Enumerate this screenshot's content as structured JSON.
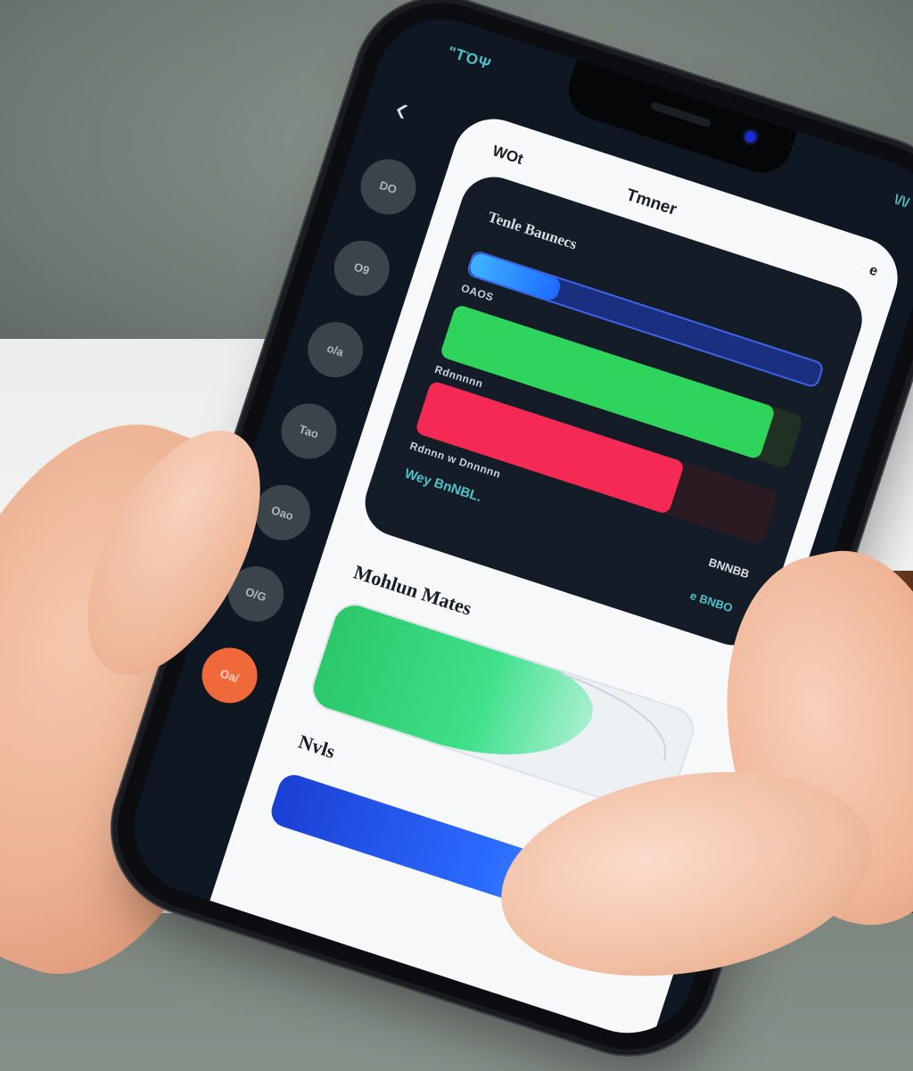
{
  "status_bar": {
    "left": "\"ΤΌΨ",
    "right": "\\/\\/"
  },
  "back_label": "‹",
  "rail_items": [
    "DO",
    "O9",
    "o/a",
    "Tao",
    "Oao",
    "O/G",
    "Oa/"
  ],
  "card": {
    "top_left": "WOt",
    "title": "Tmner",
    "top_right": "e"
  },
  "panel": {
    "title": "Tenle Baunecs",
    "bars": [
      {
        "label": "OAOS",
        "value": 0.25,
        "color": "#3fb4ff"
      },
      {
        "label": "Rdnnnnn",
        "value": 0.92,
        "color": "#2fd45c"
      },
      {
        "label": "Rdnnn w Dnnnnn",
        "value": 0.73,
        "color": "#f42a55"
      }
    ],
    "footer_left": "Wey BnNBL.",
    "footer_mid": "BNNBB",
    "footer_right": "e BNBO"
  },
  "section_1": {
    "title": "Mohlun Mates"
  },
  "section_2": {
    "title": "Nvls"
  },
  "colors": {
    "accent": "#4ec3c8",
    "active_rail": "#f0693a",
    "green": "#2fd45c",
    "red": "#f42a55",
    "blue": "#2b6bff"
  }
}
